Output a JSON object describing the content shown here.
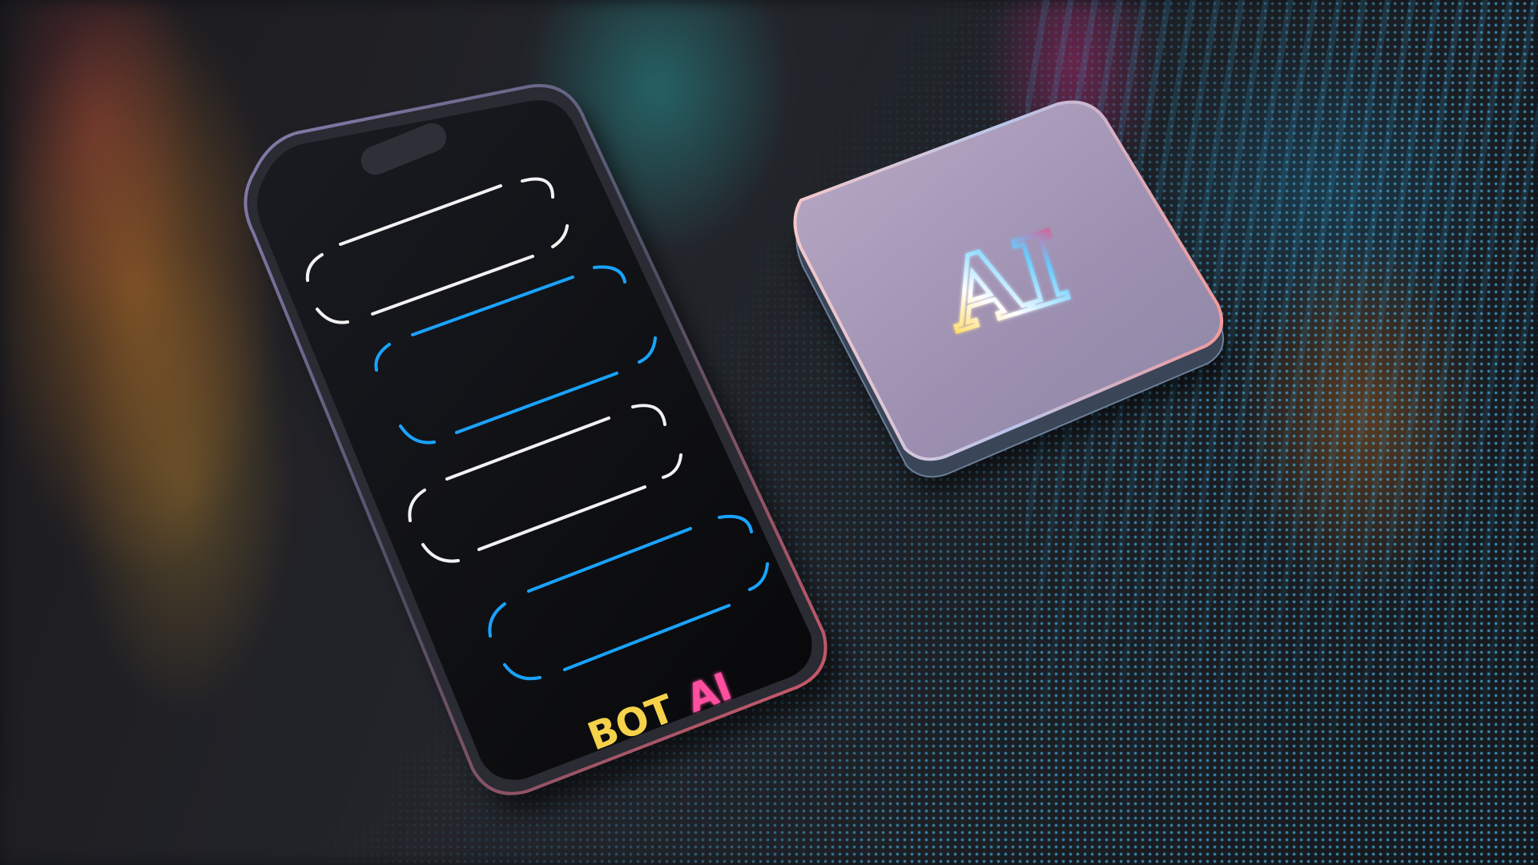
{
  "scene": {
    "phone_brand_text_part1": "BOT",
    "phone_brand_text_part2": "AI",
    "chip_label": "AI"
  },
  "colors": {
    "bubble_white": "#f2f2f2",
    "bubble_blue": "#1aa3ff",
    "bot_color": "#f5d24a",
    "ai_color": "#ff4fa0",
    "chip_face": "#a596b5"
  },
  "chat_bubbles": [
    {
      "sender": "bot",
      "style": "white"
    },
    {
      "sender": "user",
      "style": "blue"
    },
    {
      "sender": "bot",
      "style": "white"
    },
    {
      "sender": "user",
      "style": "blue"
    }
  ]
}
